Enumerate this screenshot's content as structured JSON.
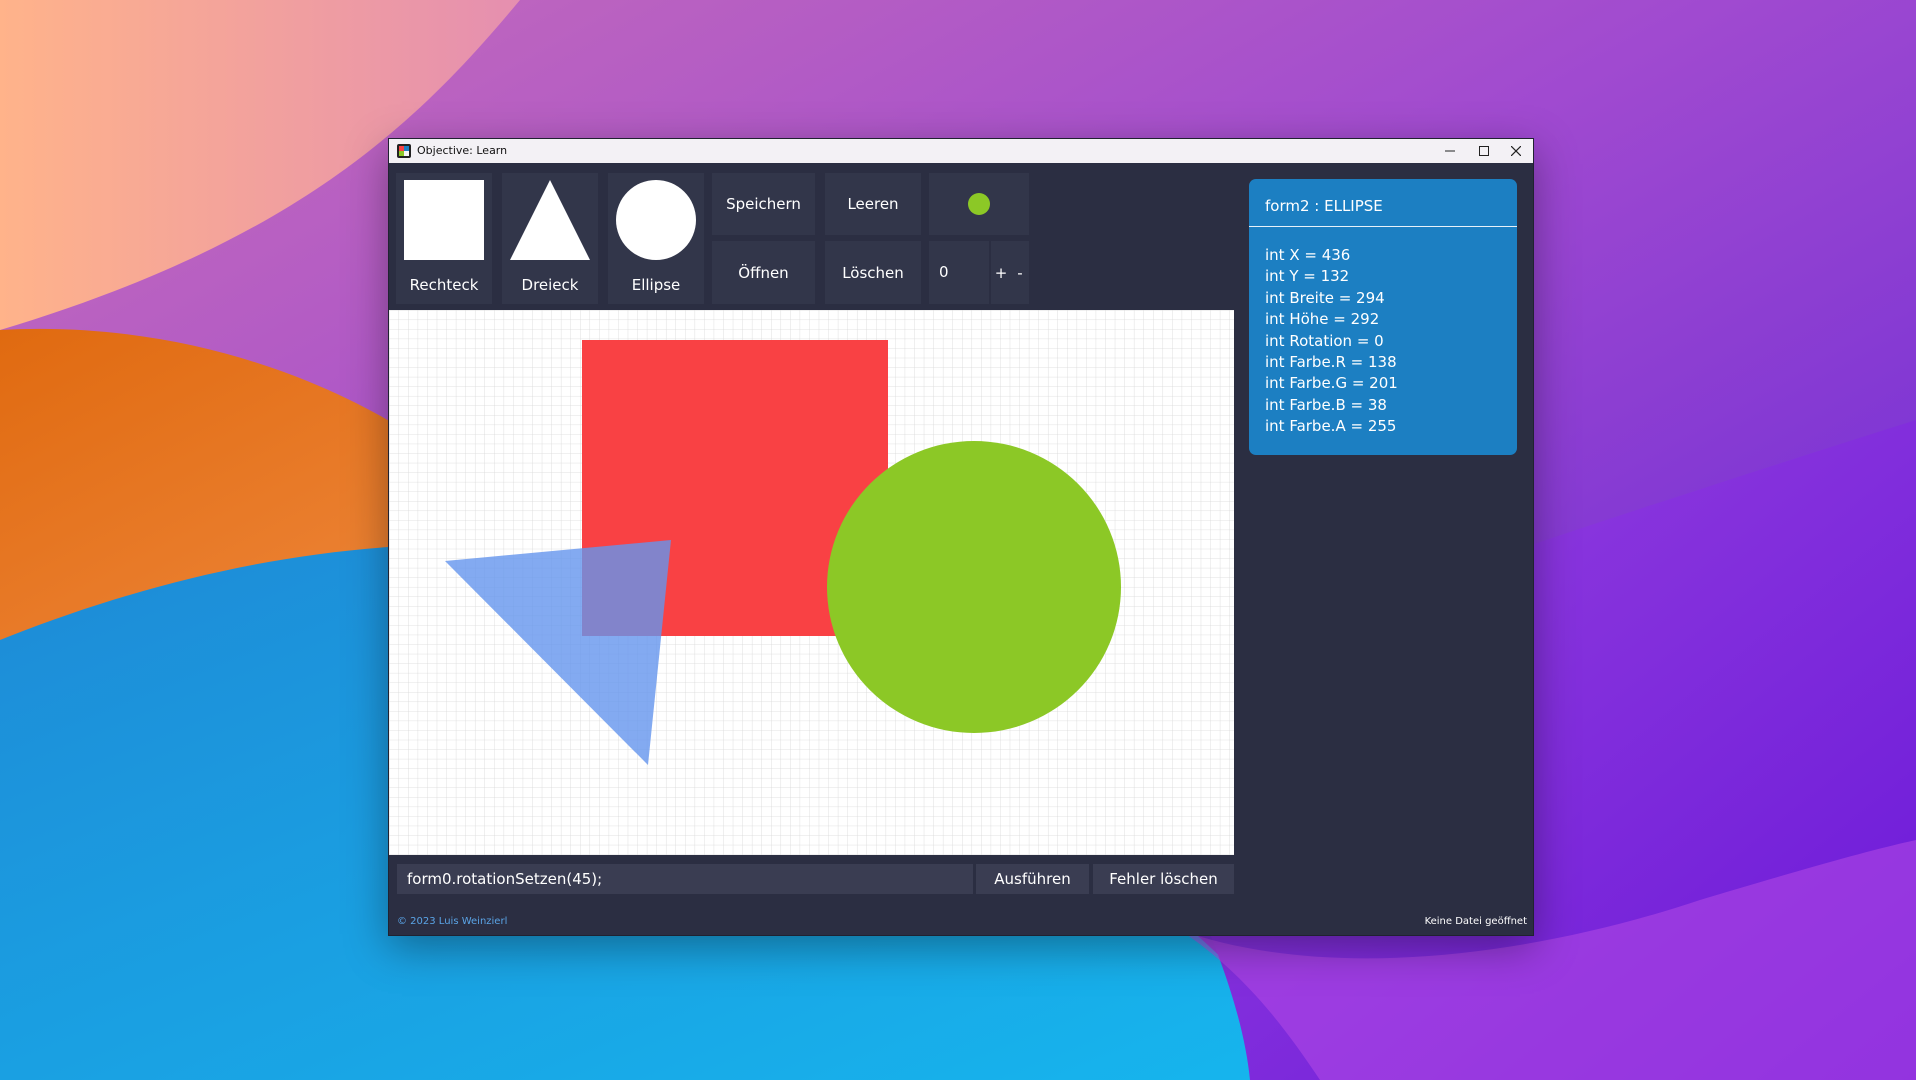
{
  "window": {
    "title": "Objective: Learn"
  },
  "titlebar_icons": {
    "minimize": "minimize-icon",
    "maximize": "maximize-icon",
    "close": "close-icon"
  },
  "shape_buttons": [
    {
      "label": "Rechteck",
      "icon": "square-icon"
    },
    {
      "label": "Dreieck",
      "icon": "triangle-icon"
    },
    {
      "label": "Ellipse",
      "icon": "circle-icon"
    }
  ],
  "actions": {
    "save": "Speichern",
    "clear": "Leeren",
    "open": "Öffnen",
    "delete": "Löschen"
  },
  "color_indicator": "#8cc826",
  "counter": {
    "value": "0",
    "plus": "+",
    "minus": "-"
  },
  "canvas": {
    "shapes": [
      {
        "type": "rectangle",
        "color": "#f94144"
      },
      {
        "type": "ellipse",
        "color": "#8cc826"
      },
      {
        "type": "triangle",
        "color": "rgba(100,149,237,0.80)"
      }
    ]
  },
  "command": {
    "value": "form0.rotationSetzen(45);",
    "run": "Ausführen",
    "clear_errors": "Fehler löschen"
  },
  "info": {
    "title": "form2 : ELLIPSE",
    "fields": [
      "int X = 436",
      "int Y = 132",
      "int Breite = 294",
      "int Höhe = 292",
      "int Rotation = 0",
      "int Farbe.R = 138",
      "int Farbe.G = 201",
      "int Farbe.B = 38",
      "int Farbe.A = 255"
    ],
    "accent": "#1c7fc2"
  },
  "footer": {
    "copyright": "© 2023 Luis Weinzierl",
    "status": "Keine Datei geöffnet"
  }
}
